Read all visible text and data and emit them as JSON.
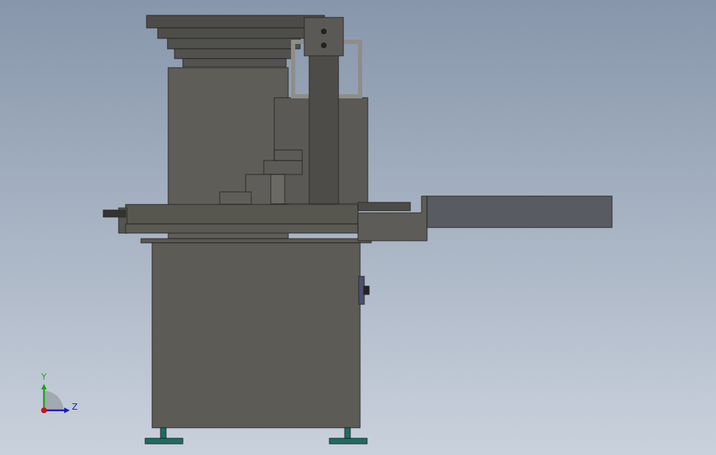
{
  "viewport": {
    "triad": {
      "axes": [
        {
          "label": "Y",
          "color": "#1aa31a",
          "kind": "vertical"
        },
        {
          "label": "Z",
          "color": "#1a1ab4",
          "kind": "horizontal"
        }
      ]
    }
  }
}
